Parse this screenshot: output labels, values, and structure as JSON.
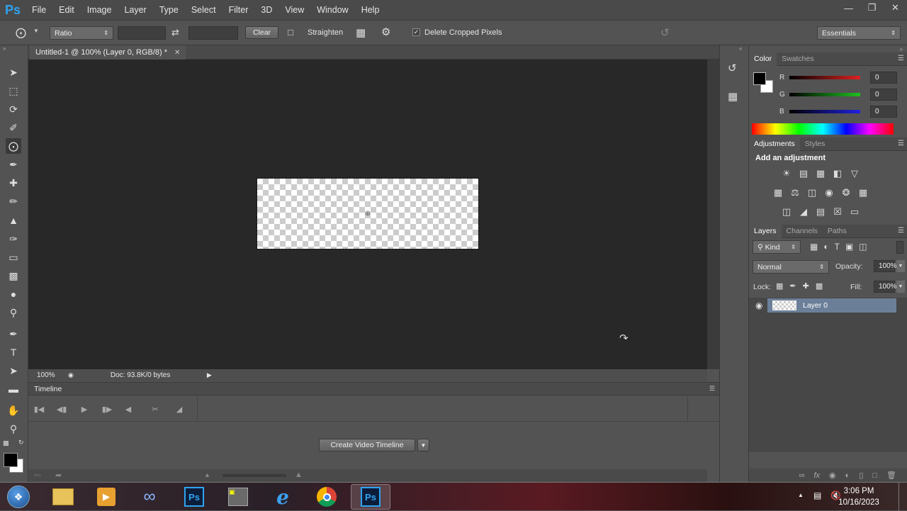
{
  "app": {
    "logo": "Ps",
    "menu": [
      "File",
      "Edit",
      "Image",
      "Layer",
      "Type",
      "Select",
      "Filter",
      "3D",
      "View",
      "Window",
      "Help"
    ],
    "window_buttons": [
      "minimize",
      "restore",
      "close"
    ]
  },
  "options": {
    "ratio_label": "Ratio",
    "clear_label": "Clear",
    "straighten_label": "Straighten",
    "delete_cropped_label": "Delete Cropped Pixels",
    "delete_cropped_checked": true,
    "workspace": "Essentials"
  },
  "document": {
    "tab_title": "Untitled-1 @ 100% (Layer 0, RGB/8) *",
    "zoom": "100%",
    "doc_info": "Doc: 93.8K/0 bytes"
  },
  "timeline": {
    "title": "Timeline",
    "create_button": "Create Video Timeline"
  },
  "color_panel": {
    "tabs": [
      "Color",
      "Swatches"
    ],
    "channels": [
      {
        "label": "R",
        "value": "0",
        "color": "#e02020"
      },
      {
        "label": "G",
        "value": "0",
        "color": "#20c020"
      },
      {
        "label": "B",
        "value": "0",
        "color": "#2020e0"
      }
    ]
  },
  "adjustments_panel": {
    "tabs": [
      "Adjustments",
      "Styles"
    ],
    "heading": "Add an adjustment"
  },
  "layers_panel": {
    "tabs": [
      "Layers",
      "Channels",
      "Paths"
    ],
    "filter_kind": "Kind",
    "blend_mode": "Normal",
    "opacity_label": "Opacity:",
    "opacity_value": "100%",
    "lock_label": "Lock:",
    "fill_label": "Fill:",
    "fill_value": "100%",
    "layers": [
      {
        "name": "Layer 0",
        "visible": true,
        "selected": true
      }
    ]
  },
  "taskbar": {
    "time": "3:06 PM",
    "date": "10/16/2023"
  }
}
